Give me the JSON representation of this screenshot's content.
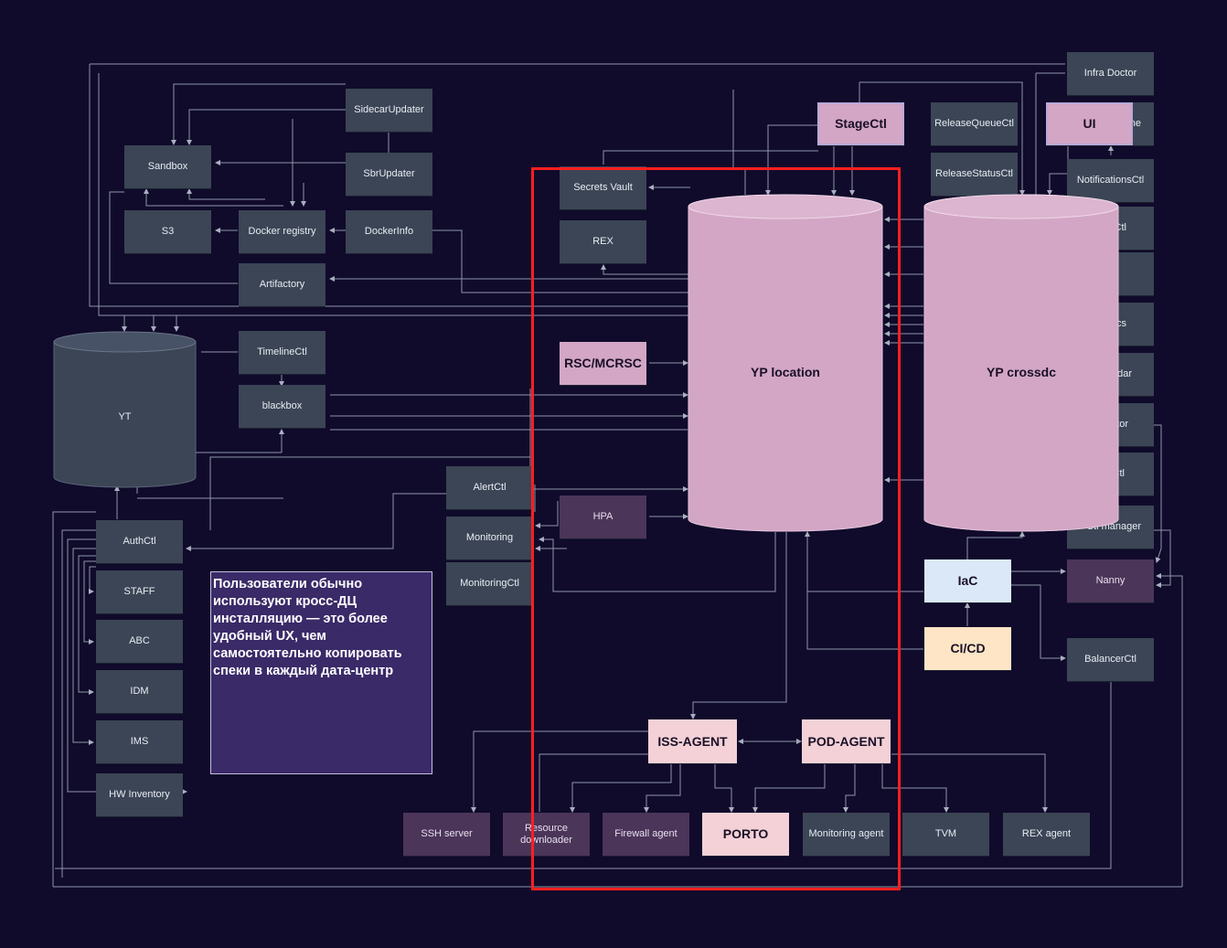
{
  "nodes": {
    "infra_doctor": "Infra Doctor",
    "sidecar_updater": "SidecarUpdater",
    "stagectl": "StageCtl",
    "release_queue_ctl": "ReleaseQueueCtl",
    "ui": "UI",
    "ui_behind": "ne",
    "sandbox": "Sandbox",
    "sbr_updater": "SbrUpdater",
    "secrets_vault": "Secrets Vault",
    "release_status_ctl": "ReleaseStatusCtl",
    "notifications_ctl": "NotificationsCtl",
    "s3": "S3",
    "docker_registry": "Docker registry",
    "docker_info": "DockerInfo",
    "rex": "REX",
    "right_col_1": "eCtl",
    "artifactory": "Artifactory",
    "right_col_2": "P",
    "right_col_3": "ics",
    "timeline_ctl": "TimelineCtl",
    "rsc_mcrsc": "RSC/MCRSC",
    "right_col_4": "tadar",
    "blackbox": "blackbox",
    "right_col_5": "tor",
    "right_col_6": "Ctl",
    "alert_ctl": "AlertCtl",
    "hpa": "HPA",
    "monitoring": "Monitoring",
    "authctl": "AuthCtl",
    "right_col_7": "Ctl manager",
    "monitoring_ctl": "MonitoringCtl",
    "iac": "IaC",
    "nanny": "Nanny",
    "staff": "STAFF",
    "abc": "ABC",
    "idm": "IDM",
    "cicd": "CI/CD",
    "balancer_ctl": "BalancerCtl",
    "ims": "IMS",
    "iss_agent": "ISS-AGENT",
    "pod_agent": "POD-AGENT",
    "hw_inventory": "HW Inventory",
    "ssh_server": "SSH server",
    "resource_downloader": "Resource downloader",
    "firewall_agent": "Firewall agent",
    "porto": "PORTO",
    "monitoring_agent": "Monitoring agent",
    "tvm": "TVM",
    "rex_agent": "REX agent"
  },
  "cylinders": {
    "yt": "YT",
    "yp_location": "YP location",
    "yp_crossdc": "YP crossdc"
  },
  "note": "Пользователи обычно используют кросс-ДЦ инсталляцию — это более удобный UX, чем самостоятельно копировать спеки в каждый дата-центр",
  "colors": {
    "background": "#100a2b",
    "node": "#3b4555",
    "yp": "#d3a6c6",
    "agent": "#f3d1d7",
    "iac": "#dbe8f8",
    "cicd": "#fde5c5",
    "note": "#3a2a68",
    "highlight": "#ff1f1f",
    "wire": "#8e96a8"
  }
}
